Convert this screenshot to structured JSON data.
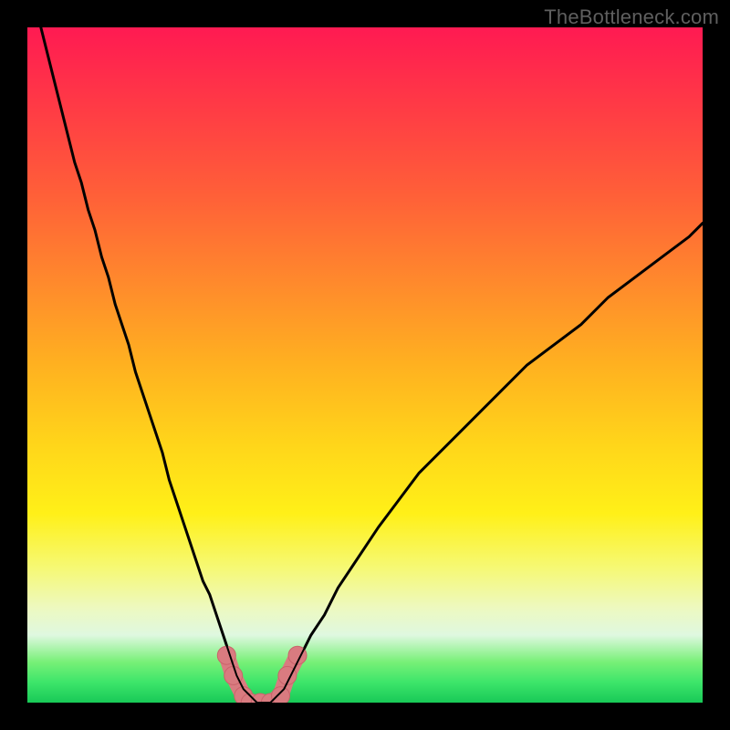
{
  "watermark": "TheBottleneck.com",
  "colors": {
    "frame": "#000000",
    "curve": "#000000",
    "marker_fill": "#d97b80",
    "marker_stroke": "#c9636a",
    "gradient_top": "#ff1a52",
    "gradient_bottom": "#18c957"
  },
  "chart_data": {
    "type": "line",
    "title": "",
    "xlabel": "",
    "ylabel": "",
    "xlim": [
      0,
      100
    ],
    "ylim": [
      0,
      100
    ],
    "grid": false,
    "curve_x": [
      2,
      3,
      4,
      5,
      6,
      7,
      8,
      9,
      10,
      11,
      12,
      13,
      14,
      15,
      16,
      17,
      18,
      19,
      20,
      21,
      22,
      23,
      24,
      25,
      26,
      27,
      28,
      29,
      30,
      31,
      32,
      33,
      34,
      35,
      36,
      37,
      38,
      39,
      40,
      41,
      42,
      44,
      46,
      48,
      50,
      52,
      55,
      58,
      62,
      66,
      70,
      74,
      78,
      82,
      86,
      90,
      94,
      98,
      100
    ],
    "curve_y": [
      100,
      96,
      92,
      88,
      84,
      80,
      77,
      73,
      70,
      66,
      63,
      59,
      56,
      53,
      49,
      46,
      43,
      40,
      37,
      33,
      30,
      27,
      24,
      21,
      18,
      16,
      13,
      10,
      7,
      4,
      2,
      1,
      0,
      0,
      0,
      1,
      2,
      4,
      6,
      8,
      10,
      13,
      17,
      20,
      23,
      26,
      30,
      34,
      38,
      42,
      46,
      50,
      53,
      56,
      60,
      63,
      66,
      69,
      71
    ],
    "markers": [
      {
        "x": 29.5,
        "y": 7
      },
      {
        "x": 30.5,
        "y": 4
      },
      {
        "x": 32,
        "y": 1
      },
      {
        "x": 33,
        "y": 0
      },
      {
        "x": 34.5,
        "y": 0
      },
      {
        "x": 36,
        "y": 0
      },
      {
        "x": 37.5,
        "y": 1
      },
      {
        "x": 38.5,
        "y": 4
      },
      {
        "x": 40,
        "y": 7
      }
    ],
    "note": "Minimum at approximately x=34–35 reaching y≈0; left branch steeper than right branch."
  }
}
